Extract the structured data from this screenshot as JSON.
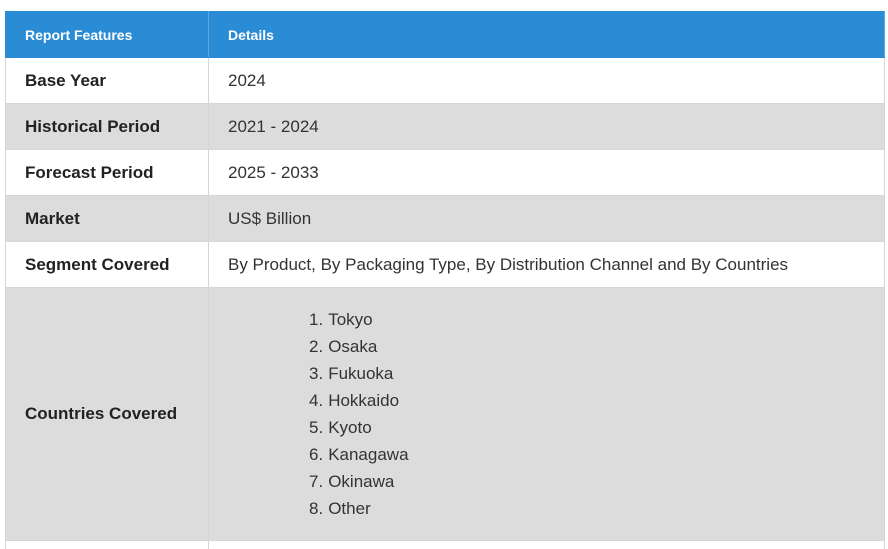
{
  "table": {
    "headers": [
      "Report Features",
      "Details"
    ],
    "rows": [
      {
        "feature": "Base Year",
        "detail": "2024"
      },
      {
        "feature": "Historical Period",
        "detail": "2021 - 2024"
      },
      {
        "feature": "Forecast Period",
        "detail": "2025 - 2033"
      },
      {
        "feature": "Market",
        "detail": "US$ Billion"
      },
      {
        "feature": "Segment Covered",
        "detail": "By Product, By Packaging Type, By Distribution Channel and By Countries"
      },
      {
        "feature": "Countries Covered",
        "list": [
          {
            "num": "1.",
            "text": "Tokyo"
          },
          {
            "num": "2.",
            "text": "Osaka"
          },
          {
            "num": "3.",
            "text": "Fukuoka"
          },
          {
            "num": "4.",
            "text": "Hokkaido"
          },
          {
            "num": "5.",
            "text": "Kyoto"
          },
          {
            "num": "6.",
            "text": "Kanagawa"
          },
          {
            "num": "7.",
            "text": "Okinawa"
          },
          {
            "num": "8.",
            "text": "Other"
          }
        ]
      }
    ]
  },
  "colors": {
    "header_bg": "#2b8cd6",
    "alt_row_bg": "#dcdcdc"
  }
}
